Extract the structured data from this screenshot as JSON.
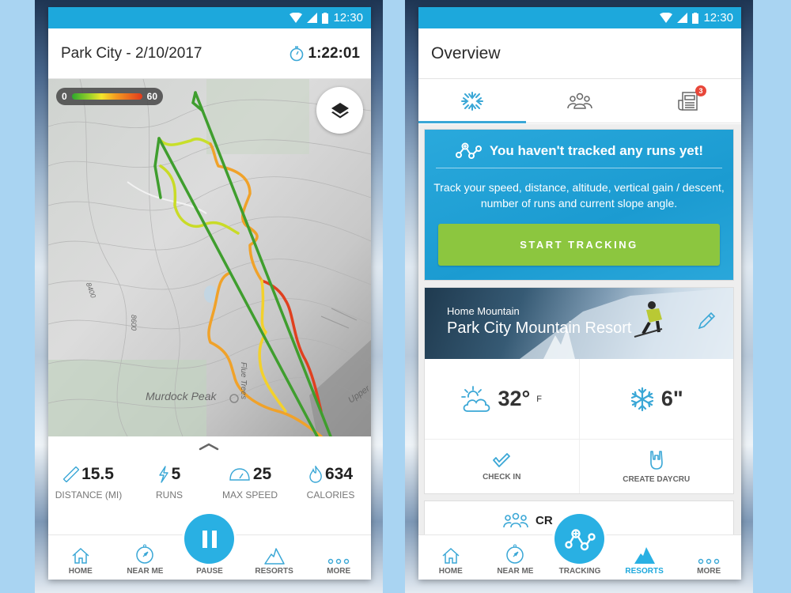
{
  "left_screen": {
    "status_bar": {
      "time": "12:30"
    },
    "header": {
      "title": "Park City - 2/10/2017",
      "timer_icon": "stopwatch-icon",
      "elapsed": "1:22:01"
    },
    "map": {
      "speed_legend": {
        "min": "0",
        "max": "60"
      },
      "layers_icon": "layers-icon",
      "labels": {
        "peak": "Murdock Peak",
        "trail": "Flue Trees",
        "upper": "Upper",
        "contour_1": "8400",
        "contour_2": "8600"
      }
    },
    "stats": [
      {
        "icon": "ruler-icon",
        "value": "15.5",
        "label": "DISTANCE (MI)"
      },
      {
        "icon": "lightning-icon",
        "value": "5",
        "label": "RUNS"
      },
      {
        "icon": "speedometer-icon",
        "value": "25",
        "label": "MAX SPEED"
      },
      {
        "icon": "flame-icon",
        "value": "634",
        "label": "CALORIES"
      }
    ],
    "nav": [
      {
        "icon": "home-icon",
        "label": "HOME"
      },
      {
        "icon": "compass-icon",
        "label": "NEAR ME"
      },
      {
        "icon": "pause-icon",
        "label": "PAUSE"
      },
      {
        "icon": "mountain-icon",
        "label": "RESORTS"
      },
      {
        "icon": "more-icon",
        "label": "MORE"
      }
    ]
  },
  "right_screen": {
    "status_bar": {
      "time": "12:30"
    },
    "header": {
      "title": "Overview"
    },
    "tabs": [
      {
        "icon": "snowflake-burst-icon",
        "active": true
      },
      {
        "icon": "group-icon",
        "active": false
      },
      {
        "icon": "newspaper-icon",
        "active": false,
        "badge": "3"
      }
    ],
    "tracking_card": {
      "title": "You haven't tracked any runs yet!",
      "description": "Track your speed, distance, altitude, vertical gain / descent, number of runs and current slope angle.",
      "button": "START TRACKING"
    },
    "mountain_card": {
      "subtitle": "Home Mountain",
      "name": "Park City Mountain Resort",
      "temperature": "32°",
      "temperature_unit": "F",
      "snowfall": "6\"",
      "actions": [
        {
          "icon": "checkmark-icon",
          "label": "CHECK IN"
        },
        {
          "icon": "rock-hand-icon",
          "label": "CREATE DAYCRU"
        }
      ]
    },
    "cru_card": {
      "label": "CR"
    },
    "nav": [
      {
        "icon": "home-icon",
        "label": "HOME",
        "active": false
      },
      {
        "icon": "compass-icon",
        "label": "NEAR ME",
        "active": false
      },
      {
        "icon": "tracking-icon",
        "label": "TRACKING",
        "active": false
      },
      {
        "icon": "mountain-icon",
        "label": "RESORTS",
        "active": true
      },
      {
        "icon": "more-icon",
        "label": "MORE",
        "active": false
      }
    ]
  },
  "colors": {
    "primary": "#1da8dc",
    "accent_green": "#8cc63f",
    "badge_red": "#e8473a",
    "speed_low": "#2da82d",
    "speed_mid": "#f4e62b",
    "speed_high": "#e23a1c"
  }
}
